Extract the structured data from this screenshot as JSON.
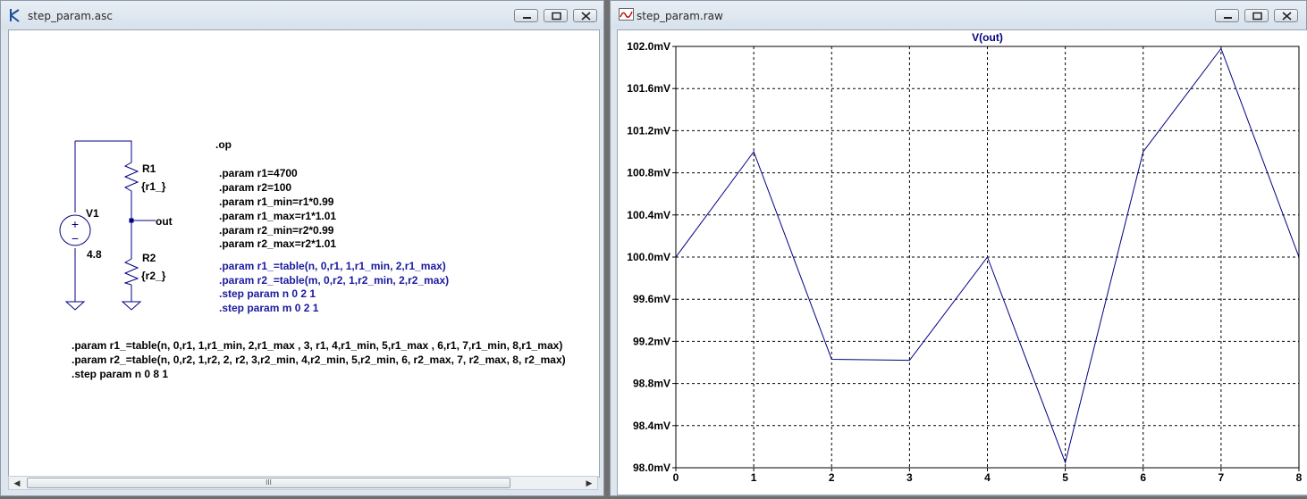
{
  "schematic_window": {
    "title": "step_param.asc",
    "circuit": {
      "v1_name": "V1",
      "v1_value": "4.8",
      "r1_name": "R1",
      "r1_value": "{r1_}",
      "r2_name": "R2",
      "r2_value": "{r2_}",
      "net_label": "out"
    },
    "directive_op": ".op",
    "params": [
      ".param r1=4700",
      ".param r2=100",
      ".param r1_min=r1*0.99",
      ".param r1_max=r1*1.01",
      ".param r2_min=r2*0.99",
      ".param r2_max=r2*1.01"
    ],
    "blue_directives": [
      ".param r1_=table(n, 0,r1, 1,r1_min, 2,r1_max)",
      ".param r2_=table(m, 0,r2, 1,r2_min, 2,r2_max)",
      ".step param n 0 2 1",
      ".step param m 0 2 1"
    ],
    "bottom_directives": [
      ".param r1_=table(n, 0,r1, 1,r1_min, 2,r1_max , 3, r1, 4,r1_min, 5,r1_max , 6,r1, 7,r1_min, 8,r1_max)",
      ".param r2_=table(n, 0,r2, 1,r2, 2, r2, 3,r2_min, 4,r2_min, 5,r2_min, 6, r2_max, 7, r2_max, 8, r2_max)",
      ".step param n 0 8 1"
    ],
    "scrollbar_grip": "III"
  },
  "plot_window": {
    "title": "step_param.raw"
  },
  "chart_data": {
    "type": "line",
    "title": "V(out)",
    "xlabel": "",
    "ylabel": "",
    "x": [
      0,
      1,
      2,
      3,
      4,
      5,
      6,
      7,
      8
    ],
    "series": [
      {
        "values": [
          100.0,
          101.0,
          99.03,
          99.02,
          100.0,
          98.05,
          101.0,
          101.98,
          100.0
        ]
      }
    ],
    "xlim": [
      0,
      8
    ],
    "ylim": [
      98.0,
      102.0
    ],
    "x_ticks": [
      "0",
      "1",
      "2",
      "3",
      "4",
      "5",
      "6",
      "7",
      "8"
    ],
    "y_tick_values": [
      98.0,
      98.4,
      98.8,
      99.2,
      99.6,
      100.0,
      100.4,
      100.8,
      101.2,
      101.6,
      102.0
    ],
    "y_ticks": [
      "98.0mV",
      "98.4mV",
      "98.8mV",
      "99.2mV",
      "99.6mV",
      "100.0mV",
      "100.4mV",
      "100.8mV",
      "101.2mV",
      "101.6mV",
      "102.0mV"
    ],
    "grid": true,
    "colors": {
      "line": "#00007f",
      "title": "#00007f",
      "grid": "#000000",
      "background": "#ffffff"
    }
  }
}
